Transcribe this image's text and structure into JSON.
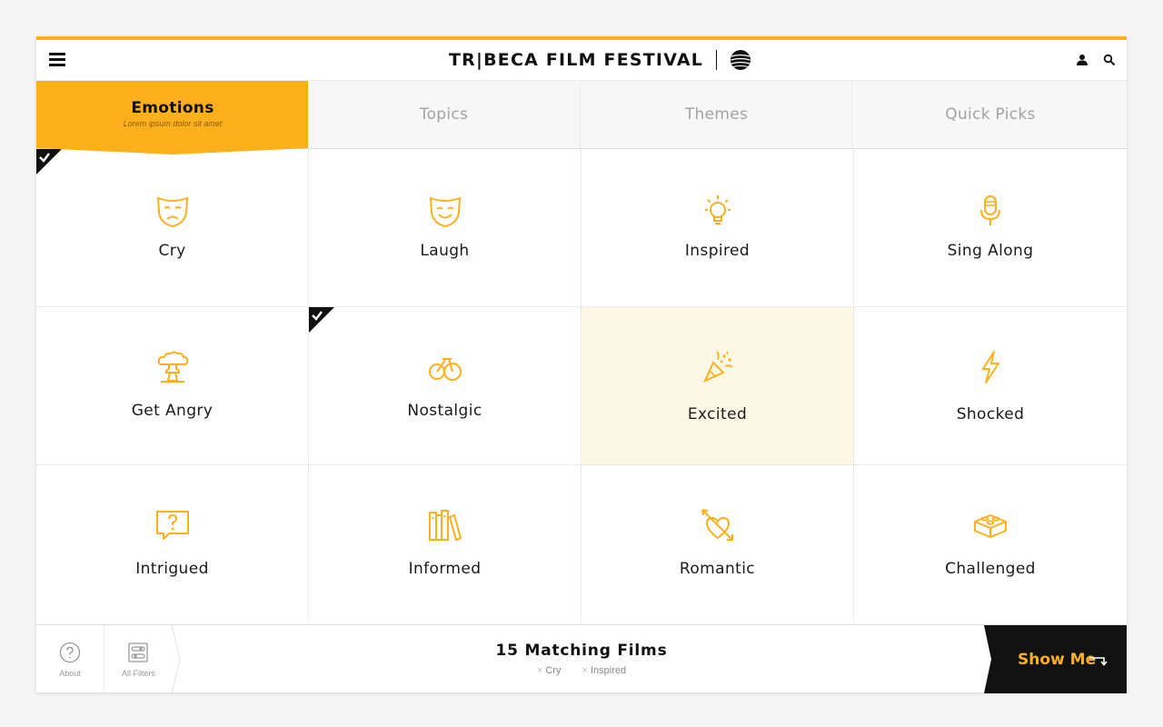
{
  "header": {
    "brand_text": "TR|BECA FILM FESTIVAL",
    "menu_icon": "hamburger-menu-icon",
    "sponsor_logo": "att-globe-logo",
    "user_icon": "user-icon",
    "search_icon": "search-icon"
  },
  "tabs": [
    {
      "label": "Emotions",
      "subtitle": "Lorem ipsum dolor sit amet",
      "active": true
    },
    {
      "label": "Topics"
    },
    {
      "label": "Themes"
    },
    {
      "label": "Quick Picks"
    }
  ],
  "emotions": [
    {
      "label": "Cry",
      "icon": "sad-mask-icon",
      "selected": true
    },
    {
      "label": "Laugh",
      "icon": "happy-mask-icon",
      "selected": false
    },
    {
      "label": "Inspired",
      "icon": "lightbulb-icon",
      "selected": false
    },
    {
      "label": "Sing Along",
      "icon": "microphone-icon",
      "selected": false
    },
    {
      "label": "Get Angry",
      "icon": "mushroom-cloud-icon",
      "selected": false
    },
    {
      "label": "Nostalgic",
      "icon": "penny-farthing-icon",
      "selected": true
    },
    {
      "label": "Excited",
      "icon": "party-popper-icon",
      "selected": false,
      "hovered": true
    },
    {
      "label": "Shocked",
      "icon": "lightning-bolt-icon",
      "selected": false
    },
    {
      "label": "Intrigued",
      "icon": "question-bubble-icon",
      "selected": false
    },
    {
      "label": "Informed",
      "icon": "books-icon",
      "selected": false
    },
    {
      "label": "Romantic",
      "icon": "heart-arrow-icon",
      "selected": false
    },
    {
      "label": "Challenged",
      "icon": "lego-brick-icon",
      "selected": false
    }
  ],
  "footer": {
    "about_label": "About",
    "filters_label": "All Filters",
    "match_count": "15 Matching Films",
    "active_filters": [
      "Cry",
      "Inspired"
    ],
    "remove_symbol": "×",
    "show_me_label": "Show Me"
  },
  "colors": {
    "accent": "#fcb11c",
    "hover_bg": "#fdf8e6",
    "dark": "#111111"
  }
}
